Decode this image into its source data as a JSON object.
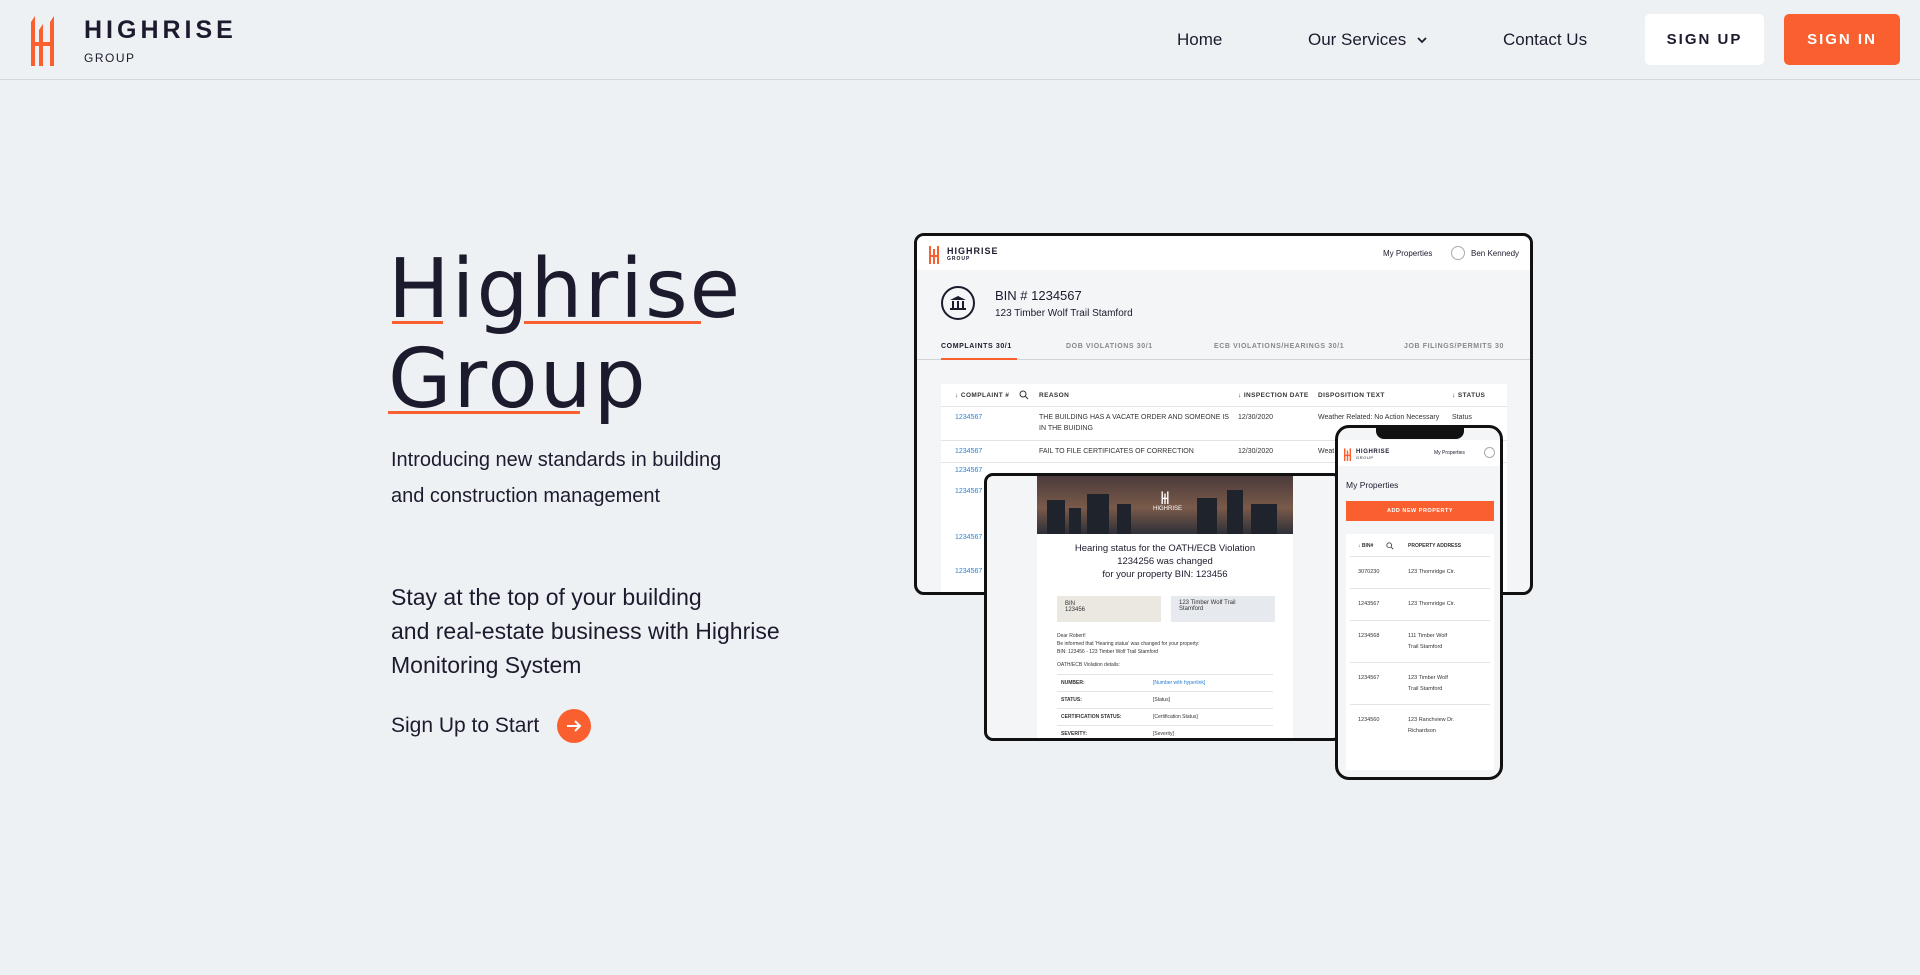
{
  "brand": {
    "name": "HIGHRISE",
    "sub": "GROUP",
    "accent": "#fa5f2f",
    "ink": "#1c1b2e"
  },
  "nav": {
    "home": "Home",
    "services": "Our Services",
    "contact": "Contact Us"
  },
  "buttons": {
    "signup": "SIGN UP",
    "signin": "SIGN IN"
  },
  "hero": {
    "title_line1": "Highrise",
    "title_line2": "Group",
    "intro_line1": "Introducing new standards in building",
    "intro_line2": "and construction management",
    "tagline_line1": "Stay at the top of your building",
    "tagline_line2": "and real-estate business with Highrise",
    "tagline_line3": "Monitoring System",
    "cta": "Sign Up to Start"
  },
  "desktop": {
    "logo": "HIGHRISE",
    "logo_sub": "GROUP",
    "nav_properties": "My Properties",
    "user": "Ben Kennedy",
    "bin": "BIN # 1234567",
    "address": "123 Timber Wolf Trail Stamford",
    "tabs": [
      "COMPLAINTS 30/1",
      "DOB VIOLATIONS  30/1",
      "ECB VIOLATIONS/HEARINGS  30/1",
      "JOB FILINGS/PERMITS 30"
    ],
    "columns": [
      "↓ COMPLAINT #",
      "REASON",
      "↓ INSPECTION DATE",
      "DISPOSITION TEXT",
      "↓ STATUS"
    ],
    "rows": [
      {
        "num": "1234567",
        "reason": "THE BUILDING HAS A VACATE ORDER AND SOMEONE IS IN THE BUIDING",
        "date": "12/30/2020",
        "disp": "Weather Related: No Action Necessary",
        "status": "Status"
      },
      {
        "num": "1234567",
        "reason": "FAIL TO FILE CERTIFICATES OF CORRECTION",
        "date": "12/30/2020",
        "disp": "Weat",
        "status": ""
      },
      {
        "num": "1234567",
        "reason": "",
        "date": "",
        "disp": "",
        "status": ""
      },
      {
        "num": "1234567",
        "reason": "",
        "date": "",
        "disp": "",
        "status": ""
      },
      {
        "num": "1234567",
        "reason": "",
        "date": "",
        "disp": "",
        "status": ""
      },
      {
        "num": "1234567",
        "reason": "",
        "date": "",
        "disp": "",
        "status": ""
      }
    ]
  },
  "tablet": {
    "logo": "HIGHRISE",
    "heading_line1": "Hearing status for the OATH/ECB Violation",
    "heading_line2": "1234256 was changed",
    "heading_line3": "for your property BIN: 123456",
    "bin_label": "BIN",
    "bin_value": "123456",
    "address_line1": "123 Timber Wolf Trail",
    "address_line2": "Stamford",
    "letter_line1": "Dear Robert!",
    "letter_line2": "Be informed that 'Hearing status' was changed for your property:",
    "letter_line3": "BIN: 123456 - 123 Timber Wolf Trail Stamford",
    "details_title": "OATH/ECB Violation details:",
    "details": [
      {
        "k": "NUMBER:",
        "v": "[Number with hyperlink]"
      },
      {
        "k": "STATUS:",
        "v": "[Status]"
      },
      {
        "k": "CERTIFICATION STATUS:",
        "v": "[Certification Status]"
      },
      {
        "k": "SEVERITY:",
        "v": "[Severity]"
      }
    ]
  },
  "phone": {
    "logo": "HIGHRISE",
    "logo_sub": "GROUP",
    "nav_properties": "My Properties",
    "title": "My Properties",
    "add_button": "ADD NEW PROPERTY",
    "columns": [
      "↓ BIN#",
      "PROPERTY ADDRESS"
    ],
    "rows": [
      {
        "bin": "3070230",
        "addr1": "123 Thornridge Cir.",
        "addr2": ""
      },
      {
        "bin": "1243567",
        "addr1": "123 Thornridge Cir.",
        "addr2": ""
      },
      {
        "bin": "1234568",
        "addr1": "111 Timber Wolf",
        "addr2": "Trail Stamford"
      },
      {
        "bin": "1234567",
        "addr1": "123 Timber Wolf",
        "addr2": "Trail Stamford"
      },
      {
        "bin": "1234560",
        "addr1": "123 Ranchview Dr.",
        "addr2": "Richardson"
      }
    ]
  }
}
